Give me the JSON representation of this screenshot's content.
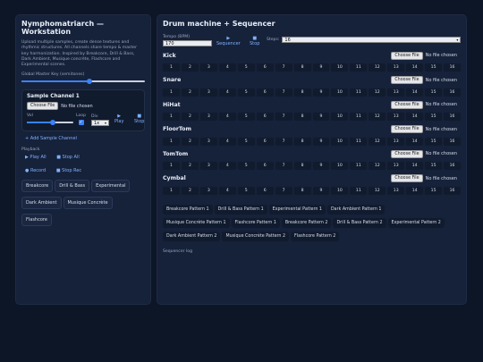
{
  "left": {
    "title": "Nymphomatriarch — Workstation",
    "description": "Upload multiple samples, create dense textures and rhythmic structures. All channels share tempo & master key harmonization. Inspired by Breakcore, Drill & Bass, Dark Ambient, Musique concrète, Flashcore and Experimental scenes.",
    "master_key_label": "Global Master Key (semitones)",
    "master_key_level": 0.55,
    "channel": {
      "title": "Sample Channel 1",
      "choose_file": "Choose File",
      "no_file": "No file chosen",
      "vol_label": "Vol",
      "vol_level": 0.55,
      "loop_label": "Loop",
      "loop_checked": true,
      "div_label": "Div",
      "div_value": "1x",
      "play_icon": "play-icon",
      "play_label": "Play",
      "stop_icon": "stop-icon",
      "stop_label": "Stop"
    },
    "add_channel": "+ Add Sample Channel",
    "playback_label": "Playback",
    "play_all": "▶ Play All",
    "stop_all": "■ Stop All",
    "record": "● Record",
    "stop_rec": "■ Stop Rec",
    "presets": [
      "Breakcore",
      "Drill & Bass",
      "Experimental",
      "Dark Ambient",
      "Musique Concrète",
      "Flashcore"
    ]
  },
  "right": {
    "title": "Drum machine + Sequencer",
    "tempo_label": "Tempo (BPM)",
    "tempo_value": "170",
    "sequencer_label": "Sequencer",
    "stop_label": "Stop",
    "steps_label": "Steps:",
    "steps_value": "16",
    "choose_file": "Choose File",
    "no_file": "No file chosen",
    "instruments": [
      "Kick",
      "Snare",
      "HiHat",
      "FloorTom",
      "TomTom",
      "Cymbal"
    ],
    "step_numbers": [
      "1",
      "2",
      "3",
      "4",
      "5",
      "6",
      "7",
      "8",
      "9",
      "10",
      "11",
      "12",
      "13",
      "14",
      "15",
      "16"
    ],
    "patterns": [
      [
        "Breakcore Pattern 1",
        "Drill & Bass Pattern 1",
        "Experimental Pattern 1",
        "Dark Ambient Pattern 1"
      ],
      [
        "Musique Concrète Pattern 1",
        "Flashcore Pattern 1",
        "Breakcore Pattern 2",
        "Drill & Bass Pattern 2",
        "Experimental Pattern 2"
      ],
      [
        "Dark Ambient Pattern 2",
        "Musique Concrète Pattern 2",
        "Flashcore Pattern 2"
      ]
    ],
    "log_label": "Sequencer log"
  },
  "colors": {
    "background": "#0d1626",
    "panel": "#16213a",
    "accent": "#3b82f6",
    "link": "#7fb2ff"
  }
}
